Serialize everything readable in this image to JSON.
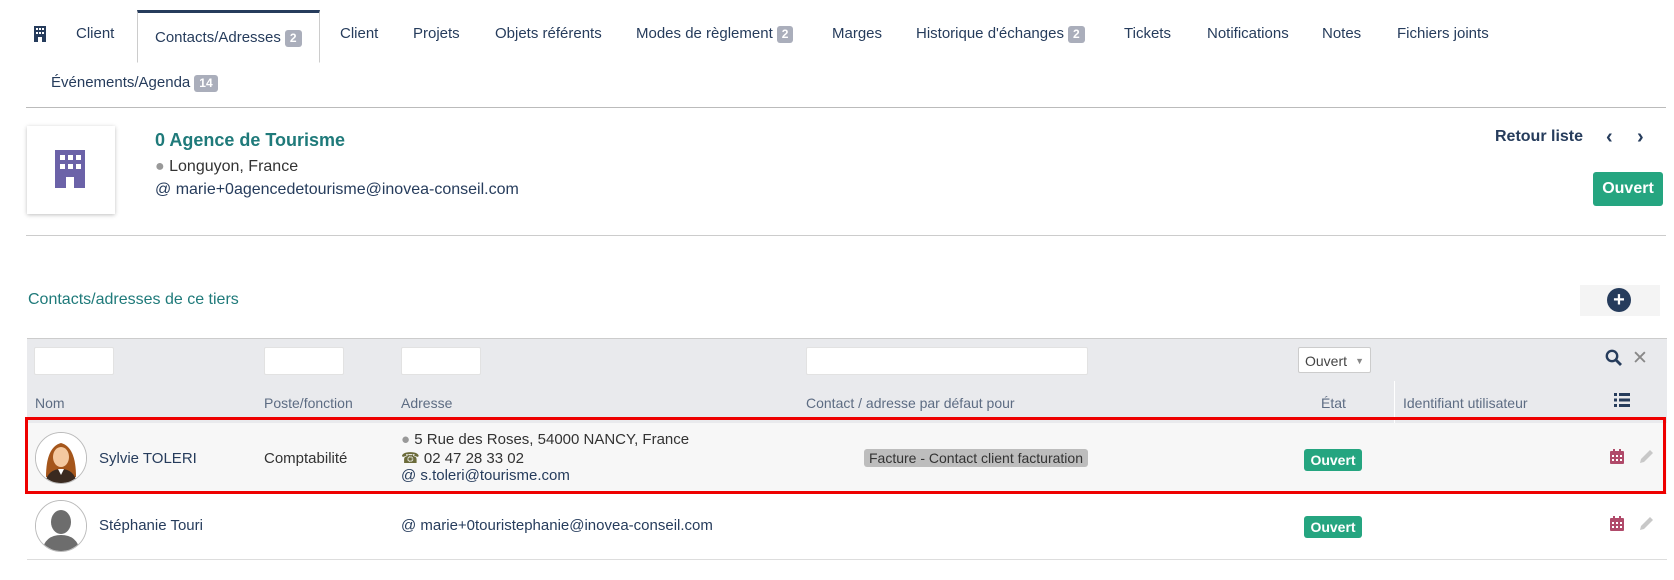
{
  "tabs": [
    {
      "label": "Client"
    },
    {
      "label": "Contacts/Adresses",
      "badge": "2"
    },
    {
      "label": "Client"
    },
    {
      "label": "Projets"
    },
    {
      "label": "Objets référents"
    },
    {
      "label": "Modes de règlement",
      "badge": "2"
    },
    {
      "label": "Marges"
    },
    {
      "label": "Historique d'échanges",
      "badge": "2"
    },
    {
      "label": "Tickets"
    },
    {
      "label": "Notifications"
    },
    {
      "label": "Notes"
    },
    {
      "label": "Fichiers joints"
    },
    {
      "label": "Événements/Agenda",
      "badge": "14"
    }
  ],
  "tiers": {
    "name": "0 Agence de Tourisme",
    "town": "Longuyon, France",
    "email": "marie+0agencedetourisme@inovea-conseil.com",
    "status": "Ouvert"
  },
  "nav": {
    "back_label": "Retour liste",
    "prev": "‹",
    "next": "›"
  },
  "section": {
    "title": "Contacts/adresses de ce tiers",
    "add_icon": "+"
  },
  "filters": {
    "status_selected": "Ouvert",
    "search_icon": "search-icon",
    "clear_icon": "close-icon"
  },
  "columns": {
    "name": "Nom",
    "role": "Poste/fonction",
    "address": "Adresse",
    "default_for": "Contact / adresse par défaut pour",
    "state": "État",
    "user_id": "Identifiant utilisateur"
  },
  "rows": [
    {
      "name": "Sylvie TOLERI",
      "role": "Comptabilité",
      "address": "5 Rue des Roses, 54000 NANCY, France",
      "phone": "02 47 28 33 02",
      "email": "s.toleri@tourisme.com",
      "default_for": "Facture - Contact client facturation",
      "state": "Ouvert"
    },
    {
      "name": "Stéphanie Touri",
      "role": "",
      "email": "marie+0touristephanie@inovea-conseil.com",
      "state": "Ouvert"
    }
  ],
  "colors": {
    "accent": "#263c5c",
    "teal": "#1f7a7a",
    "status_green": "#25a580",
    "highlight": "#e00000"
  }
}
